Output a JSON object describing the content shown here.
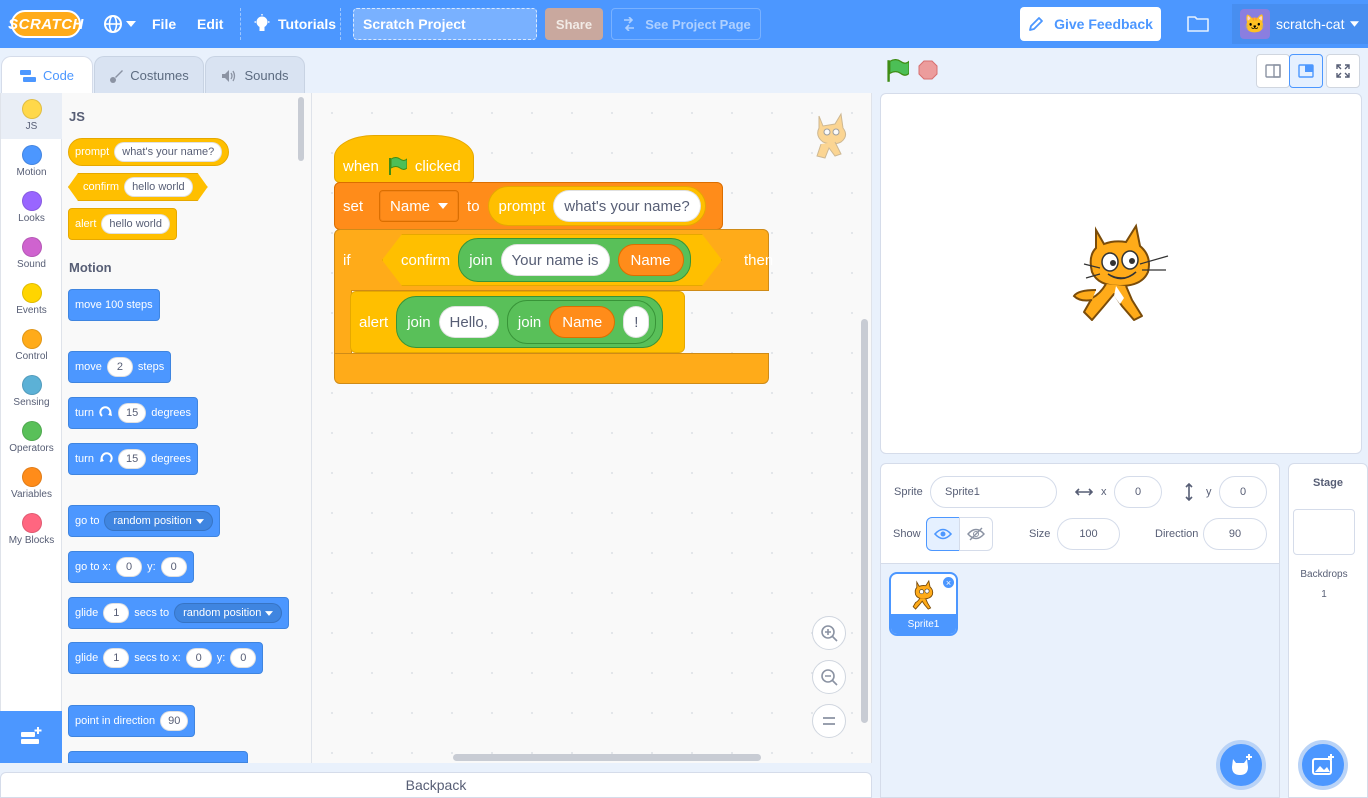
{
  "menubar": {
    "logo": "SCRATCH",
    "file": "File",
    "edit": "Edit",
    "tutorials": "Tutorials",
    "project_title": "Scratch Project",
    "share": "Share",
    "see_project_page": "See Project Page",
    "give_feedback": "Give Feedback",
    "username": "scratch-cat"
  },
  "tabs": {
    "code": "Code",
    "costumes": "Costumes",
    "sounds": "Sounds"
  },
  "categories": [
    {
      "label": "JS",
      "color": "#ffd84a"
    },
    {
      "label": "Motion",
      "color": "#4c97ff"
    },
    {
      "label": "Looks",
      "color": "#9966ff"
    },
    {
      "label": "Sound",
      "color": "#cf63cf"
    },
    {
      "label": "Events",
      "color": "#ffd500"
    },
    {
      "label": "Control",
      "color": "#ffab19"
    },
    {
      "label": "Sensing",
      "color": "#5cb1d6"
    },
    {
      "label": "Operators",
      "color": "#59c059"
    },
    {
      "label": "Variables",
      "color": "#ff8c1a"
    },
    {
      "label": "My Blocks",
      "color": "#ff6680"
    }
  ],
  "palette": {
    "js_heading": "JS",
    "prompt": {
      "label": "prompt",
      "value": "what's your name?"
    },
    "confirm": {
      "label": "confirm",
      "value": "hello world"
    },
    "alert": {
      "label": "alert",
      "value": "hello world"
    },
    "motion_heading": "Motion",
    "move_100": "move 100 steps",
    "move": {
      "a": "move",
      "n": "2",
      "b": "steps"
    },
    "turn_right": {
      "a": "turn",
      "n": "15",
      "b": "degrees"
    },
    "turn_left": {
      "a": "turn",
      "n": "15",
      "b": "degrees"
    },
    "goto": {
      "a": "go to",
      "opt": "random position"
    },
    "gotoxy": {
      "a": "go to x:",
      "x": "0",
      "yl": "y:",
      "y": "0"
    },
    "glide1": {
      "a": "glide",
      "n": "1",
      "b": "secs to",
      "opt": "random position"
    },
    "glide2": {
      "a": "glide",
      "n": "1",
      "b": "secs to x:",
      "x": "0",
      "yl": "y:",
      "y": "0"
    },
    "point": {
      "a": "point in direction",
      "n": "90"
    }
  },
  "script": {
    "hat": {
      "when": "when",
      "clicked": "clicked"
    },
    "set": {
      "set": "set",
      "var": "Name",
      "to": "to",
      "prompt": "prompt",
      "question": "what's your name?"
    },
    "if": {
      "if": "if",
      "confirm": "confirm",
      "join": "join",
      "text": "Your name is",
      "var": "Name",
      "then": "then"
    },
    "alert": {
      "alert": "alert",
      "join1": "join",
      "hello": "Hello,",
      "join2": "join",
      "var": "Name",
      "bang": "!"
    }
  },
  "backpack": "Backpack",
  "sprite_info": {
    "sprite_label": "Sprite",
    "sprite_name": "Sprite1",
    "x_label": "x",
    "x": "0",
    "y_label": "y",
    "y": "0",
    "show_label": "Show",
    "size_label": "Size",
    "size": "100",
    "direction_label": "Direction",
    "direction": "90"
  },
  "sprites": [
    {
      "name": "Sprite1"
    }
  ],
  "stage_panel": {
    "title": "Stage",
    "backdrops_label": "Backdrops",
    "backdrops_count": "1"
  }
}
